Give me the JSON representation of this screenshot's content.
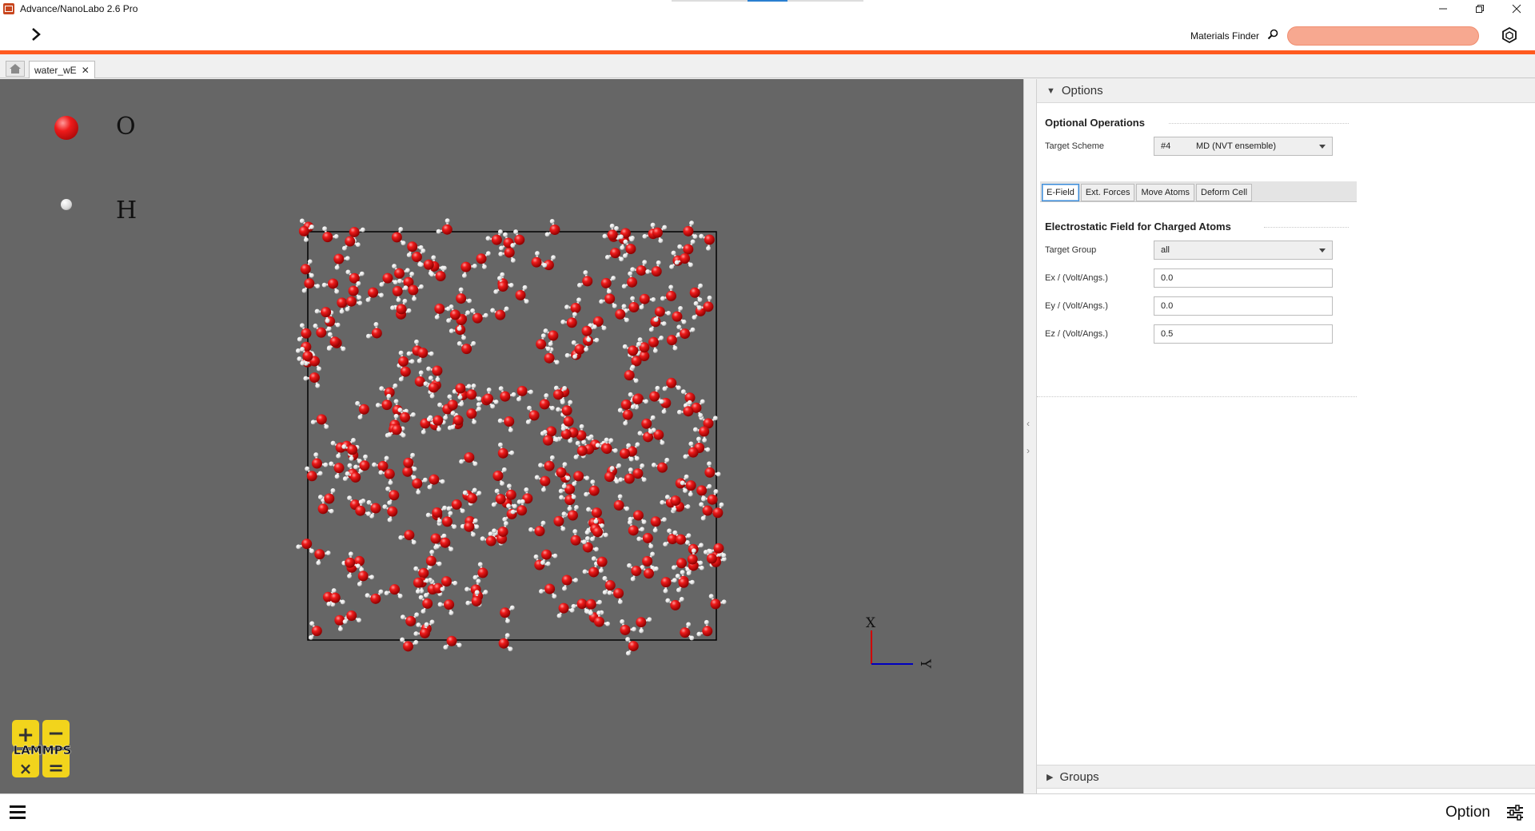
{
  "window": {
    "title": "Advance/NanoLabo 2.6 Pro",
    "controls": [
      "minimize-icon",
      "restore-icon",
      "close-icon"
    ],
    "accent_color": "#ff5a1f"
  },
  "toolbar": {
    "materials_finder_label": "Materials Finder",
    "search_value": ""
  },
  "tabs": {
    "home_icon": "home-icon",
    "document_tab_label": "water_wE"
  },
  "viewport": {
    "legend": [
      {
        "element": "O",
        "color": "#ee1b1b"
      },
      {
        "element": "H",
        "color": "#e0e0e0"
      }
    ],
    "axis_labels": {
      "vertical": "X",
      "horizontal": "Y"
    },
    "logo_text": "LAMMPS",
    "logo_symbols": [
      "+",
      "−",
      "×",
      "="
    ]
  },
  "panel": {
    "options_header": "Options",
    "optional_operations_heading": "Optional Operations",
    "target_scheme_label": "Target Scheme",
    "target_scheme_number": "#4",
    "target_scheme_value": "MD (NVT ensemble)",
    "subtabs": [
      "E-Field",
      "Ext. Forces",
      "Move Atoms",
      "Deform Cell"
    ],
    "active_subtab": "E-Field",
    "efield_heading": "Electrostatic Field for Charged Atoms",
    "target_group_label": "Target Group",
    "target_group_value": "all",
    "ex_label": "Ex / (Volt/Angs.)",
    "ex_value": "0.0",
    "ey_label": "Ey / (Volt/Angs.)",
    "ey_value": "0.0",
    "ez_label": "Ez / (Volt/Angs.)",
    "ez_value": "0.5",
    "groups_header": "Groups"
  },
  "statusbar": {
    "option_label": "Option"
  }
}
